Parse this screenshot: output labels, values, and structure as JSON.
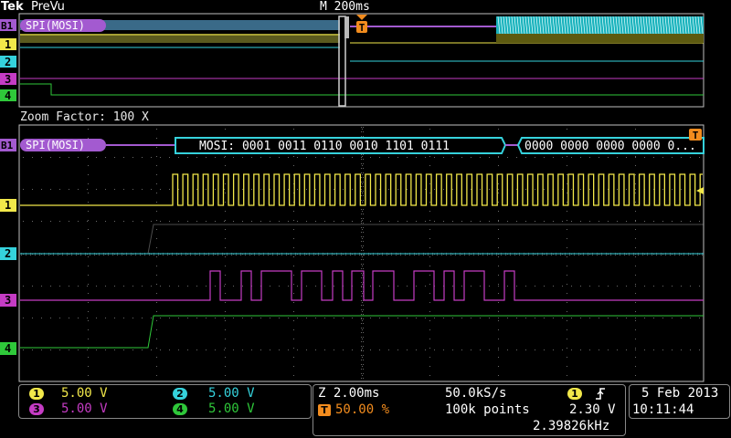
{
  "header": {
    "brand": "Tek",
    "mode": "PreVu",
    "timebase": "M 200ms"
  },
  "zoom_label": "Zoom Factor: 100 X",
  "bus": {
    "marker": "B1",
    "name": "SPI(MOSI)",
    "packet": "MOSI: 0001 0011 0110 0010 1101 0111",
    "packet2": "0000 0000 0000 0000 0..."
  },
  "trigger_marker": "T",
  "channels": [
    {
      "id": "1",
      "scale": "5.00 V",
      "color": "#f2e84a"
    },
    {
      "id": "2",
      "scale": "5.00 V",
      "color": "#35d2dc"
    },
    {
      "id": "3",
      "scale": "5.00 V",
      "color": "#c53cc4"
    },
    {
      "id": "4",
      "scale": "5.00 V",
      "color": "#2fc83a"
    }
  ],
  "acq": {
    "zoom_time": "Z 2.00ms",
    "sample_rate": "50.0kS/s",
    "trigger_pos": "50.00 %",
    "record_length": "100k points",
    "trigger_source": "1",
    "trigger_level": "2.30 V",
    "frequency": "2.39826kHz"
  },
  "datetime": {
    "date": "5 Feb  2013",
    "time": "10:11:44"
  },
  "colors": {
    "bus": "#a35ad0",
    "grid": "#6a6a6a",
    "border": "#bfbfbf",
    "trigger": "#f28c1e"
  }
}
